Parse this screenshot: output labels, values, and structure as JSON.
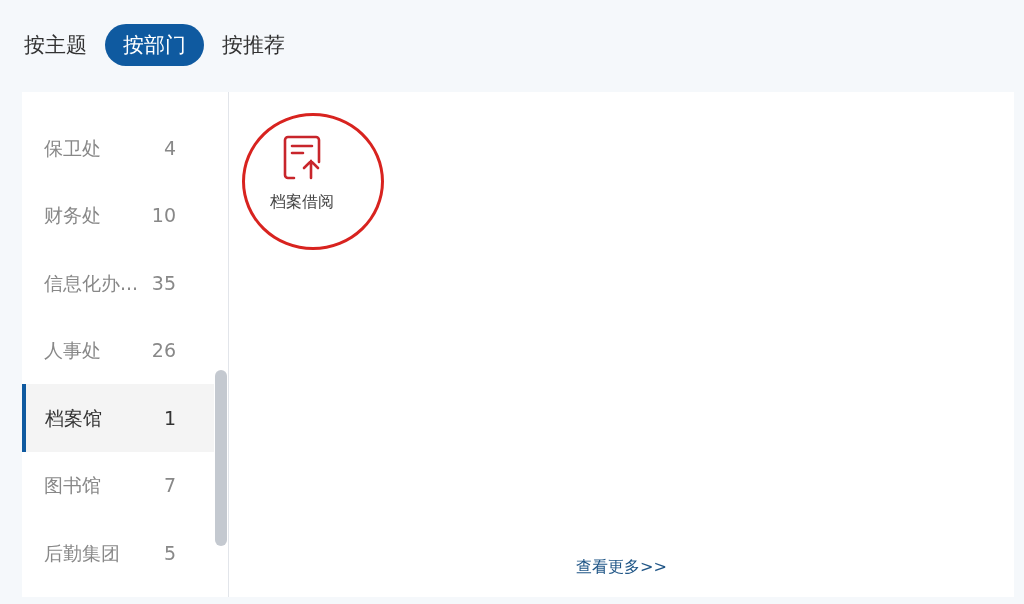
{
  "tabs": [
    {
      "label": "按主题",
      "selected": false
    },
    {
      "label": "按部门",
      "selected": true
    },
    {
      "label": "按推荐",
      "selected": false
    }
  ],
  "departments": [
    {
      "name": "保卫处",
      "count": "4",
      "selected": false
    },
    {
      "name": "财务处",
      "count": "10",
      "selected": false
    },
    {
      "name": "信息化办...",
      "count": "35",
      "selected": false
    },
    {
      "name": "人事处",
      "count": "26",
      "selected": false
    },
    {
      "name": "档案馆",
      "count": "1",
      "selected": true
    },
    {
      "name": "图书馆",
      "count": "7",
      "selected": false
    },
    {
      "name": "后勤集团",
      "count": "5",
      "selected": false
    }
  ],
  "apps": [
    {
      "label": "档案借阅",
      "highlighted": true
    }
  ],
  "more_link": "查看更多>>"
}
